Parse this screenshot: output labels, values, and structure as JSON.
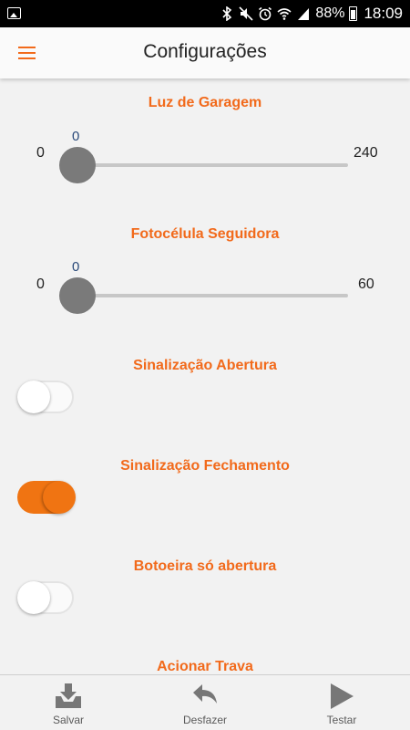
{
  "status_bar": {
    "battery_percent": "88%",
    "time": "18:09"
  },
  "header": {
    "title": "Configurações"
  },
  "sections": {
    "luz_garagem": {
      "title": "Luz de Garagem",
      "value": "0",
      "min": "0",
      "max": "240"
    },
    "fotocelula": {
      "title": "Fotocélula Seguidora",
      "value": "0",
      "min": "0",
      "max": "60"
    },
    "sinal_abertura": {
      "title": "Sinalização Abertura",
      "enabled": false
    },
    "sinal_fechamento": {
      "title": "Sinalização Fechamento",
      "enabled": true
    },
    "botoeira": {
      "title": "Botoeira só abertura",
      "enabled": false
    },
    "acionar_trava": {
      "title": "Acionar Trava"
    }
  },
  "bottom_bar": {
    "save_label": "Salvar",
    "undo_label": "Desfazer",
    "test_label": "Testar"
  },
  "colors": {
    "accent": "#f26a1b",
    "toggle_on": "#f07412",
    "slider_thumb": "#7a7a7a"
  }
}
